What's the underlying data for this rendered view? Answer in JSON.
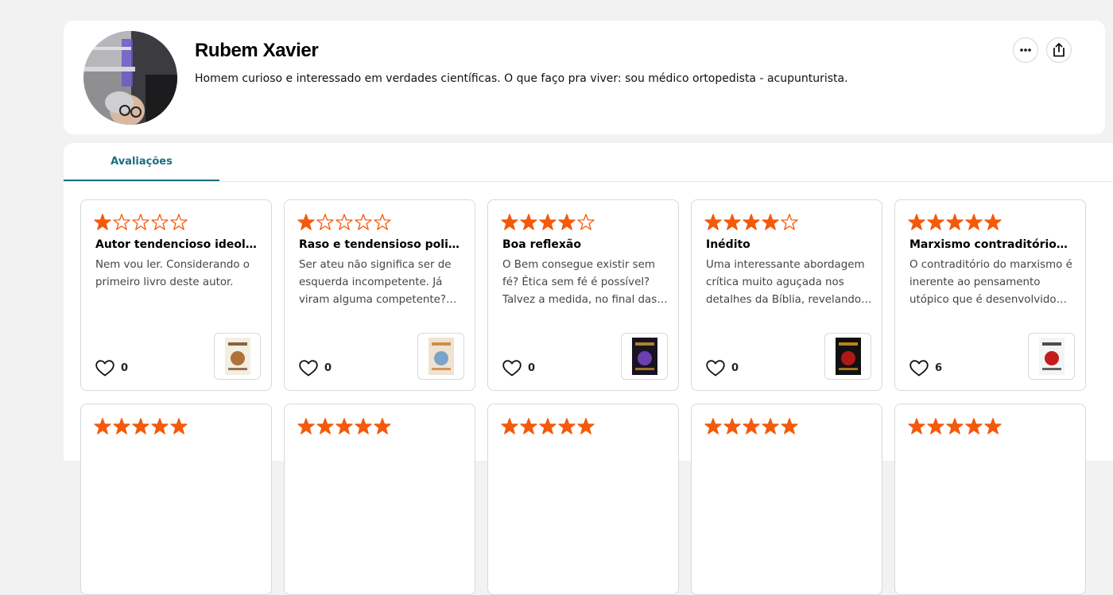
{
  "profile": {
    "name": "Rubem Xavier",
    "bio": "Homem curioso e interessado em verdades científicas. O que faço pra viver: sou médico ortopedista - acupunturista."
  },
  "tabs": [
    {
      "label": "Avaliações",
      "active": true
    }
  ],
  "colors": {
    "accent": "#1b6e80",
    "star": "#f35a0c"
  },
  "reviews": [
    {
      "rating": 1,
      "title": "Autor tendencioso ideológicamente",
      "text": "Nem vou ler. Considerando o primeiro livro deste autor.",
      "likes": "0",
      "cover_icon": "book-cover-icon"
    },
    {
      "rating": 1,
      "title": "Raso e tendensioso politicamente",
      "text": "Ser ateu não significa ser de esquerda incompetente. Já viram alguma competente? Nenhum.",
      "likes": "0",
      "cover_icon": "book-cover-icon"
    },
    {
      "rating": 4,
      "title": "Boa reflexão",
      "text": "O Bem consegue existir sem fé? Ética sem fé é possível? Talvez a medida, no final das contas.",
      "likes": "0",
      "cover_icon": "book-cover-icon"
    },
    {
      "rating": 4,
      "title": "Inédito",
      "text": "Uma interessante abordagem crítica muito aguçada nos detalhes da Bíblia, revelando suas contradições.",
      "likes": "0",
      "cover_icon": "book-cover-icon"
    },
    {
      "rating": 5,
      "title": "Marxismo contraditório? Verdade",
      "text": "O contraditório do marxismo é inerente ao pensamento utópico que é desenvolvido por seus seguidores.",
      "likes": "6",
      "cover_icon": "book-cover-icon"
    },
    {
      "rating": 5
    },
    {
      "rating": 5
    },
    {
      "rating": 5
    },
    {
      "rating": 5
    },
    {
      "rating": 5
    }
  ]
}
